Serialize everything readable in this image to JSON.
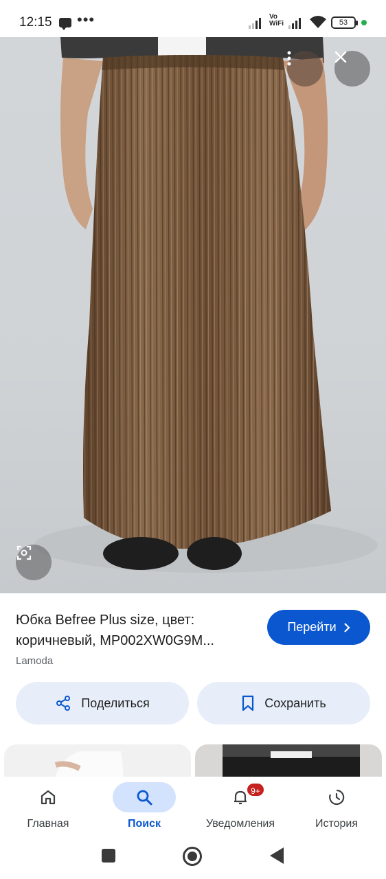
{
  "status_bar": {
    "time": "12:15",
    "dots": "•••",
    "vowifi": "Vo WiFi",
    "battery": "53"
  },
  "image": {
    "icons": [
      "more-vert-icon",
      "close-icon",
      "lens-icon"
    ]
  },
  "product": {
    "title": "Юбка Befree Plus size, цвет: коричневый, MP002XW0G9M...",
    "source": "Lamoda",
    "goto_label": "Перейти",
    "share_label": "Поделиться",
    "save_label": "Сохранить"
  },
  "bottom_nav": {
    "items": [
      {
        "label": "Главная",
        "icon": "home-icon"
      },
      {
        "label": "Поиск",
        "icon": "search-icon"
      },
      {
        "label": "Уведомления",
        "icon": "bell-icon",
        "badge": "9+"
      },
      {
        "label": "История",
        "icon": "history-icon"
      }
    ]
  },
  "colors": {
    "accent": "#0b57d0",
    "pill_bg": "#e7eef9",
    "badge": "#c5221f",
    "skirt": "#7a5a3c"
  }
}
